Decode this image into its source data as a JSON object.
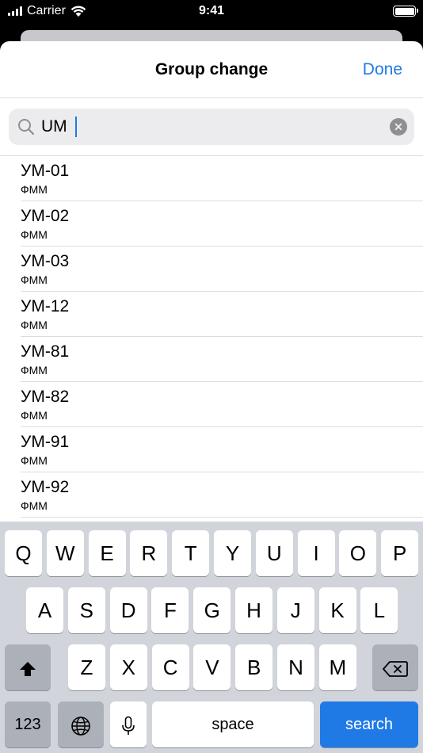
{
  "status_bar": {
    "carrier": "Carrier",
    "time": "9:41"
  },
  "nav": {
    "title": "Group change",
    "done_label": "Done"
  },
  "search": {
    "value": "UM",
    "clear_icon": "clear-icon",
    "search_icon": "magnifying-glass-icon"
  },
  "groups": [
    {
      "name": "УМ-01",
      "faculty": "ФММ"
    },
    {
      "name": "УМ-02",
      "faculty": "ФММ"
    },
    {
      "name": "УМ-03",
      "faculty": "ФММ"
    },
    {
      "name": "УМ-12",
      "faculty": "ФММ"
    },
    {
      "name": "УМ-81",
      "faculty": "ФММ"
    },
    {
      "name": "УМ-82",
      "faculty": "ФММ"
    },
    {
      "name": "УМ-91",
      "faculty": "ФММ"
    },
    {
      "name": "УМ-92",
      "faculty": "ФММ"
    }
  ],
  "keyboard": {
    "row1": [
      "Q",
      "W",
      "E",
      "R",
      "T",
      "Y",
      "U",
      "I",
      "O",
      "P"
    ],
    "row2": [
      "A",
      "S",
      "D",
      "F",
      "G",
      "H",
      "J",
      "K",
      "L"
    ],
    "row3": [
      "Z",
      "X",
      "C",
      "V",
      "B",
      "N",
      "M"
    ],
    "numbers_label": "123",
    "space_label": "space",
    "search_label": "search"
  },
  "colors": {
    "accent": "#1f7ae6",
    "keyboard_bg": "#d1d4da"
  }
}
